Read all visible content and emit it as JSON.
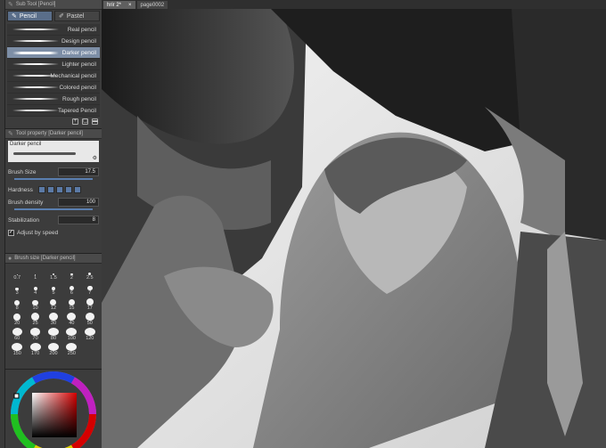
{
  "sub_tool": {
    "header": "Sub Tool [Pencil]",
    "tabs": [
      {
        "label": "Pencil",
        "active": true
      },
      {
        "label": "Pastel",
        "active": false
      }
    ],
    "brushes": [
      {
        "label": "Real pencil",
        "selected": false
      },
      {
        "label": "Design pencil",
        "selected": false
      },
      {
        "label": "Darker pencil",
        "selected": true
      },
      {
        "label": "Lighter pencil",
        "selected": false
      },
      {
        "label": "Mechanical pencil",
        "selected": false
      },
      {
        "label": "Colored pencil",
        "selected": false
      },
      {
        "label": "Rough pencil",
        "selected": false
      },
      {
        "label": "Tapered Pencil",
        "selected": false
      }
    ]
  },
  "tool_property": {
    "header": "Tool property [Darker pencil]",
    "preset_name": "Darker pencil",
    "brush_size_label": "Brush Size",
    "brush_size_value": "17.5",
    "hardness_label": "Hardness",
    "brush_density_label": "Brush density",
    "brush_density_value": "100",
    "stabilization_label": "Stabilization",
    "stabilization_value": "8",
    "adjust_by_speed_label": "Adjust by speed"
  },
  "brush_size": {
    "header": "Brush size [Darker pencil]",
    "sizes": [
      "0.7",
      "1",
      "1.5",
      "2",
      "2.5",
      "3",
      "4",
      "5",
      "6",
      "7",
      "8",
      "10",
      "12",
      "15",
      "17",
      "20",
      "25",
      "30",
      "40",
      "50",
      "60",
      "70",
      "80",
      "100",
      "120",
      "150",
      "170",
      "200",
      "250"
    ]
  },
  "canvas_tabs": [
    {
      "label": "hrir 2*",
      "active": true
    },
    {
      "label": "page0002",
      "active": false
    }
  ],
  "colors": {
    "accent": "#5a6e8a",
    "selected_brush": "#7d8ea6",
    "color_wheel_main": "#d40000"
  }
}
